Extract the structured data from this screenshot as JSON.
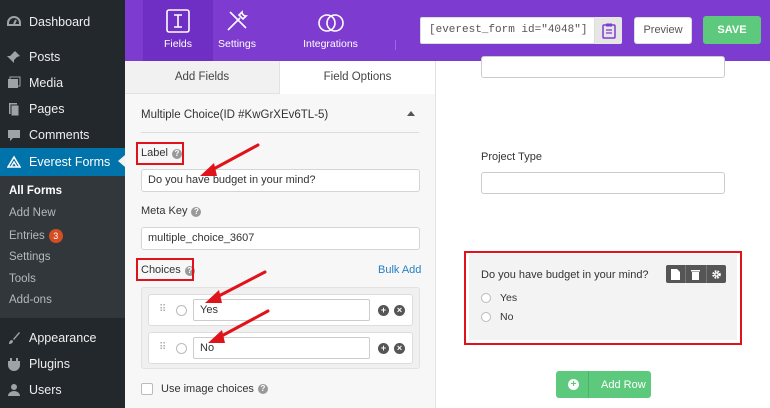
{
  "wp_menu": {
    "dashboard": "Dashboard",
    "posts": "Posts",
    "media": "Media",
    "pages": "Pages",
    "comments": "Comments",
    "everest_forms": "Everest Forms",
    "submenu": {
      "all_forms": "All Forms",
      "add_new": "Add New",
      "entries": "Entries",
      "entries_count": "3",
      "settings": "Settings",
      "tools": "Tools",
      "addons": "Add-ons"
    },
    "appearance": "Appearance",
    "plugins": "Plugins",
    "users": "Users"
  },
  "toolbar": {
    "tab_fields": "Fields",
    "tab_settings": "Settings",
    "tab_integrations": "Integrations",
    "shortcode": "[everest_form id=\"4048\"]",
    "preview_label": "Preview",
    "save_label": "SAVE"
  },
  "panel": {
    "tab_add_fields": "Add Fields",
    "tab_field_options": "Field Options",
    "section_title": "Multiple Choice(ID #KwGrXEv6TL-5)",
    "label_label": "Label",
    "label_value": "Do you have budget in your mind?",
    "meta_key_label": "Meta Key",
    "meta_key_value": "multiple_choice_3607",
    "choices_label": "Choices",
    "bulk_add": "Bulk Add",
    "choices": [
      "Yes",
      "No"
    ],
    "use_image_choices": "Use image choices"
  },
  "canvas": {
    "project_type_label": "Project Type",
    "question": "Do you have budget in your mind?",
    "options": [
      "Yes",
      "No"
    ],
    "add_row_label": "Add Row"
  },
  "colors": {
    "toolbar_purple": "#7e3bd0",
    "wp_active_blue": "#0073aa",
    "save_green": "#5cc97d",
    "annotation_red": "#e0131a"
  }
}
